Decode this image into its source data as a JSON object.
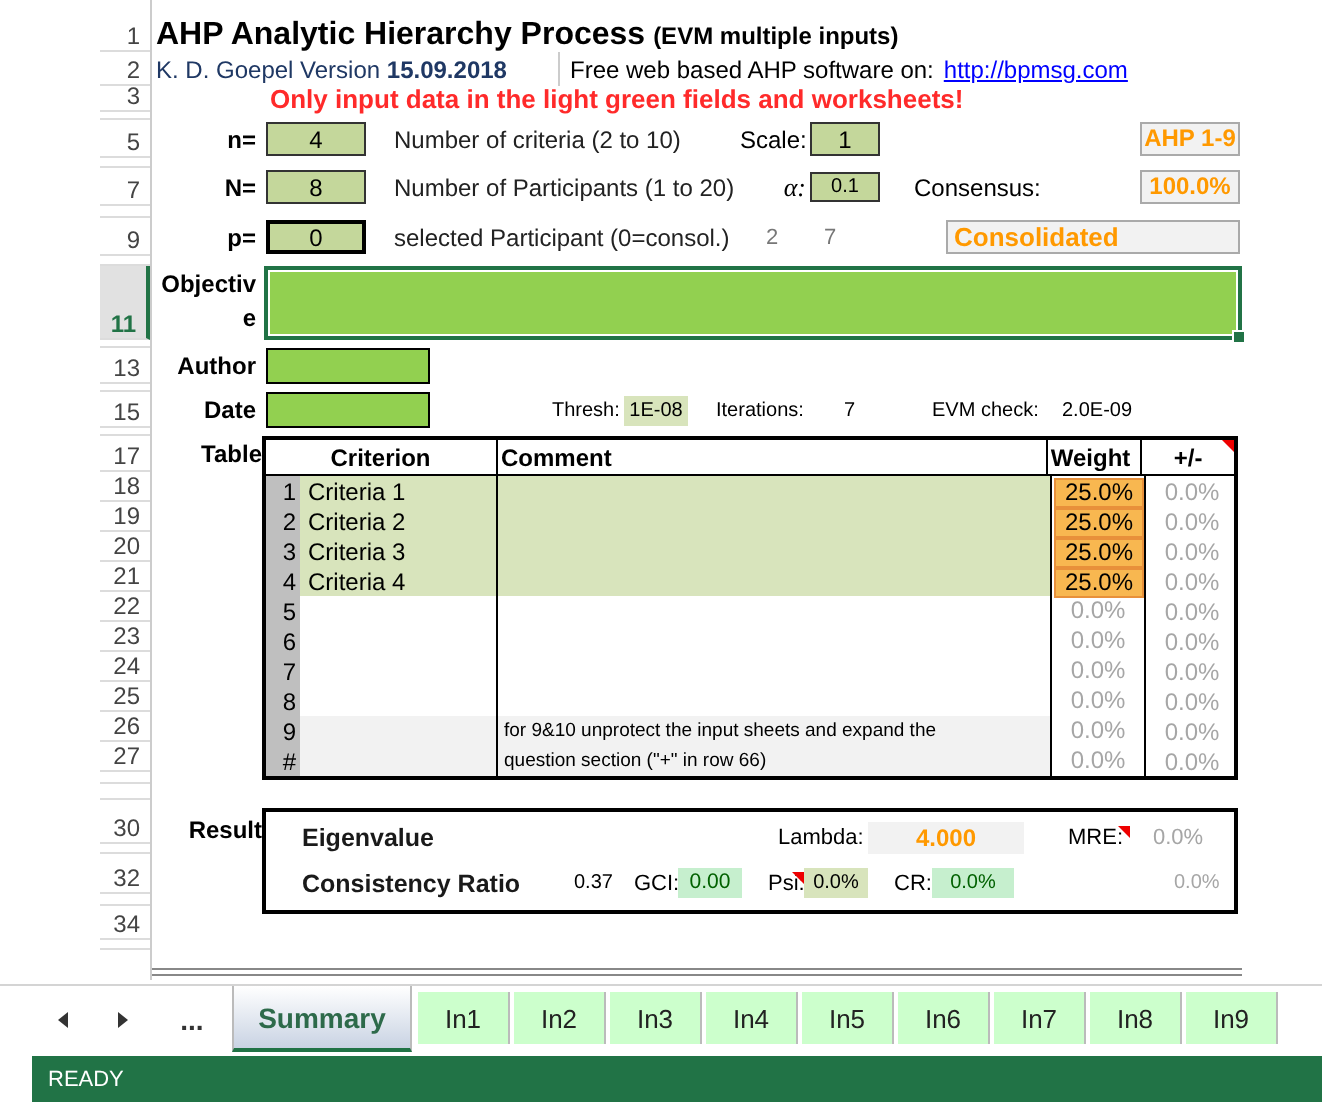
{
  "row_headers": [
    {
      "label": "1",
      "selected": false
    },
    {
      "label": "2",
      "selected": false
    },
    {
      "label": "3",
      "selected": false
    },
    {
      "label": "5",
      "selected": false
    },
    {
      "label": "7",
      "selected": false
    },
    {
      "label": "9",
      "selected": false
    },
    {
      "label": "11",
      "selected": true
    },
    {
      "label": "13",
      "selected": false
    },
    {
      "label": "15",
      "selected": false
    },
    {
      "label": "17",
      "selected": false
    },
    {
      "label": "18",
      "selected": false
    },
    {
      "label": "19",
      "selected": false
    },
    {
      "label": "20",
      "selected": false
    },
    {
      "label": "21",
      "selected": false
    },
    {
      "label": "22",
      "selected": false
    },
    {
      "label": "23",
      "selected": false
    },
    {
      "label": "24",
      "selected": false
    },
    {
      "label": "25",
      "selected": false
    },
    {
      "label": "26",
      "selected": false
    },
    {
      "label": "27",
      "selected": false
    },
    {
      "label": "30",
      "selected": false
    },
    {
      "label": "32",
      "selected": false
    },
    {
      "label": "34",
      "selected": false
    }
  ],
  "title": {
    "main": "AHP Analytic Hierarchy Process",
    "sub": "(EVM multiple inputs)"
  },
  "author_version": "K. D. Goepel Version **15.09.2018**",
  "web": {
    "label": "Free web based AHP software on:",
    "link": "http://bpmsg.com"
  },
  "notice": "Only input data in the light green fields and worksheets!",
  "params": [
    {
      "label": "n=",
      "value": "4",
      "description": "Number of criteria (2 to 10)",
      "outlined": false
    },
    {
      "label": "N=",
      "value": "8",
      "description": "Number of Participants (1 to 20)",
      "outlined": false
    },
    {
      "label": "p=",
      "value": "0",
      "description": "selected Participant (0=consol.)",
      "outlined": true
    }
  ],
  "scale": {
    "label": "Scale:",
    "value": "1",
    "name": "AHP 1-9"
  },
  "alpha": {
    "label": "α:",
    "value": "0.1"
  },
  "consensus": {
    "label": "Consensus:",
    "value": "100.0%"
  },
  "participant_info": {
    "value_1": "2",
    "value_2": "7",
    "status": "Consolidated"
  },
  "objective": {
    "label": "Objective"
  },
  "author": {
    "label": "Author"
  },
  "date": {
    "label": "Date"
  },
  "evm": {
    "thresh_label": "Thresh:",
    "thresh": "1E-08",
    "iterations_label": "Iterations:",
    "iterations": "7",
    "check_label": "EVM check:",
    "check": "2.0E-09"
  },
  "table": {
    "label": "Table",
    "columns": [
      "Criterion",
      "Comment",
      "Weight",
      "+/-"
    ],
    "rows": [
      {
        "kind": "input",
        "index": "1",
        "criterion": "Criteria 1",
        "weight": "25.0%",
        "delta": "0.0%"
      },
      {
        "kind": "input",
        "index": "2",
        "criterion": "Criteria 2",
        "weight": "25.0%",
        "delta": "0.0%"
      },
      {
        "kind": "input",
        "index": "3",
        "criterion": "Criteria 3",
        "weight": "25.0%",
        "delta": "0.0%"
      },
      {
        "kind": "input",
        "index": "4",
        "criterion": "Criteria 4",
        "weight": "25.0%",
        "delta": "0.0%"
      },
      {
        "kind": "empty",
        "index": "5",
        "weight": "0.0%",
        "delta": "0.0%"
      },
      {
        "kind": "empty",
        "index": "6",
        "weight": "0.0%",
        "delta": "0.0%"
      },
      {
        "kind": "empty",
        "index": "7",
        "weight": "0.0%",
        "delta": "0.0%"
      },
      {
        "kind": "empty",
        "index": "8",
        "weight": "0.0%",
        "delta": "0.0%"
      },
      {
        "kind": "locked",
        "index": "9",
        "comment": "for 9&10 unprotect the input sheets and expand the",
        "weight": "0.0%",
        "delta": "0.0%"
      },
      {
        "kind": "locked",
        "index": "#",
        "comment": "question section (\"+\" in row 66)",
        "weight": "0.0%",
        "delta": "0.0%"
      }
    ]
  },
  "result": {
    "label": "Result",
    "eigenvalue": "Eigenvalue",
    "lambda_label": "Lambda:",
    "lambda": "4.000",
    "mre_label": "MRE:",
    "mre": "0.0%",
    "cr_label": "Consistency Ratio",
    "cr_raw": "0.37",
    "gci_label": "GCI:",
    "gci": "0.00",
    "psi_label": "Psi:",
    "psi": "0.0%",
    "cr_short_label": "CR:",
    "cr": "0.0%",
    "extra": "0.0%"
  },
  "sheet_tabs": {
    "more": "...",
    "tabs": [
      {
        "label": "Summary",
        "selected": true
      },
      {
        "label": "In1",
        "selected": false
      },
      {
        "label": "In2",
        "selected": false
      },
      {
        "label": "In3",
        "selected": false
      },
      {
        "label": "In4",
        "selected": false
      },
      {
        "label": "In5",
        "selected": false
      },
      {
        "label": "In6",
        "selected": false
      },
      {
        "label": "In7",
        "selected": false
      },
      {
        "label": "In8",
        "selected": false
      },
      {
        "label": "In9",
        "selected": false
      }
    ]
  },
  "status_bar": {
    "text": "READY"
  }
}
